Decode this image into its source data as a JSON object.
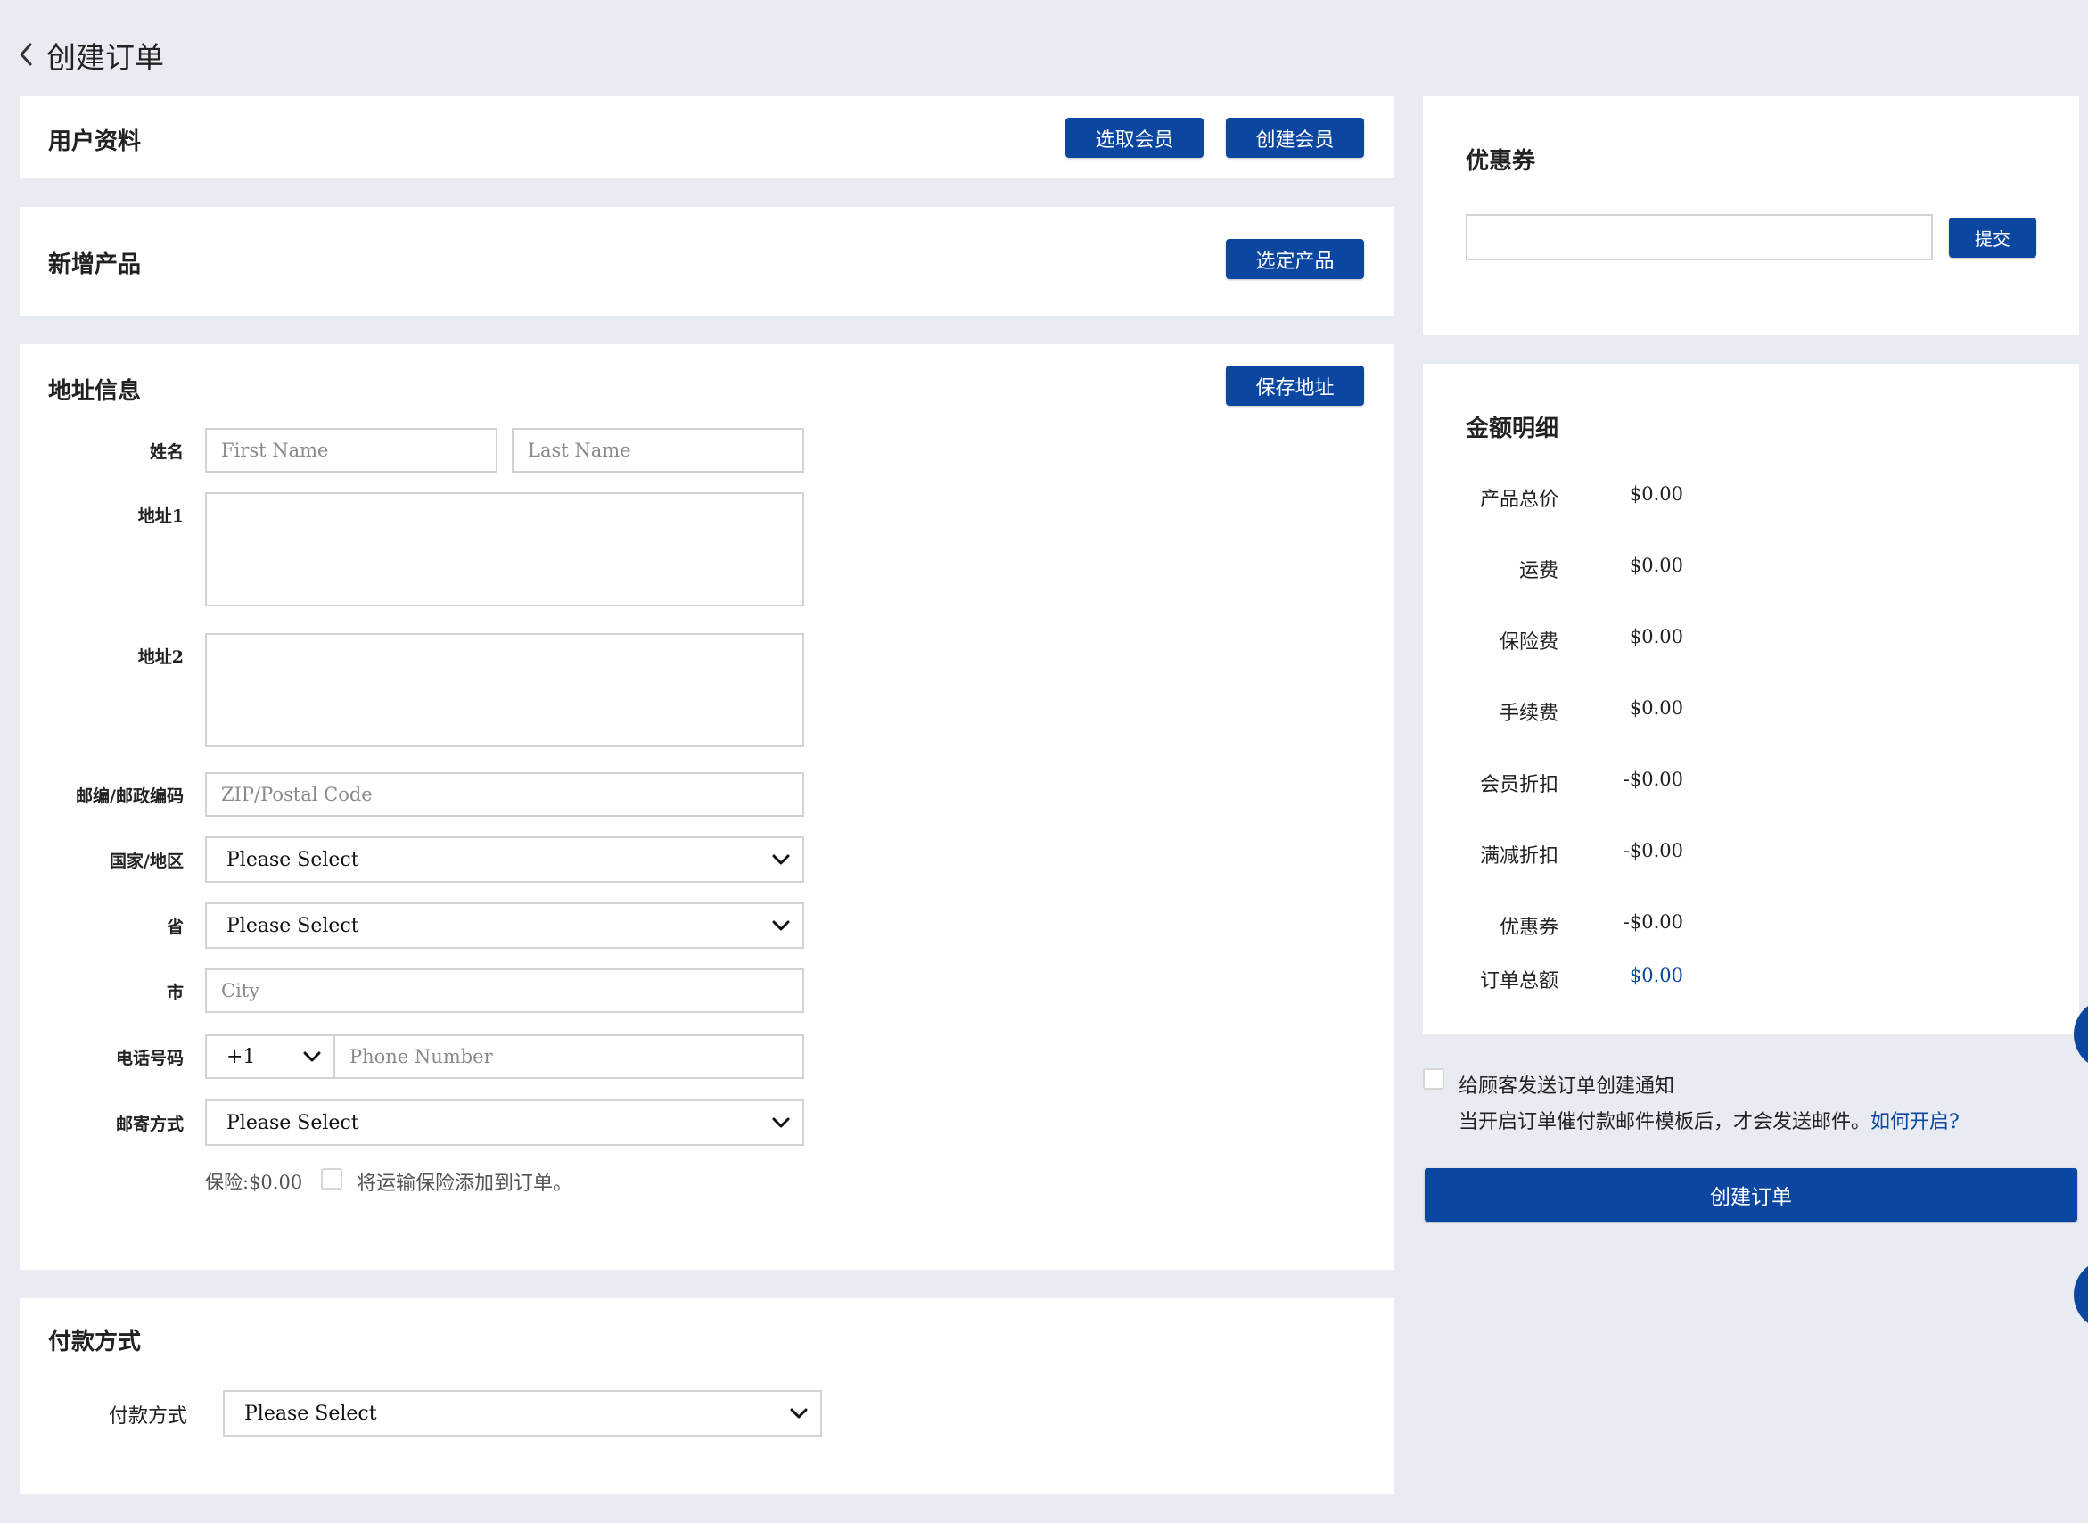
{
  "header": {
    "title": "创建订单"
  },
  "user_section": {
    "title": "用户资料",
    "select_member": "选取会员",
    "create_member": "创建会员"
  },
  "product_section": {
    "title": "新增产品",
    "select_product": "选定产品"
  },
  "address_section": {
    "title": "地址信息",
    "save_address": "保存地址",
    "name_label": "姓名",
    "first_name_placeholder": "First Name",
    "last_name_placeholder": "Last Name",
    "address1_label": "地址1",
    "address2_label": "地址2",
    "zip_label": "邮编/邮政编码",
    "zip_placeholder": "ZIP/Postal Code",
    "country_label": "国家/地区",
    "country_value": "Please Select",
    "province_label": "省",
    "province_value": "Please Select",
    "city_label": "市",
    "city_placeholder": "City",
    "phone_label": "电话号码",
    "phone_code": "+1",
    "phone_placeholder": "Phone Number",
    "shipping_label": "邮寄方式",
    "shipping_value": "Please Select",
    "insurance_text": "保险:$0.00",
    "insurance_checkbox_label": "将运输保险添加到订单。"
  },
  "payment_section": {
    "title": "付款方式",
    "label": "付款方式",
    "value": "Please Select"
  },
  "coupon_section": {
    "title": "优惠券",
    "submit": "提交"
  },
  "summary": {
    "title": "金额明细",
    "rows": [
      {
        "label": "产品总价",
        "value": "$0.00"
      },
      {
        "label": "运费",
        "value": "$0.00"
      },
      {
        "label": "保险费",
        "value": "$0.00"
      },
      {
        "label": "手续费",
        "value": "$0.00"
      },
      {
        "label": "会员折扣",
        "value": "-$0.00"
      },
      {
        "label": "满减折扣",
        "value": "-$0.00"
      },
      {
        "label": "优惠券",
        "value": "-$0.00"
      }
    ],
    "total_label": "订单总额",
    "total_value": "$0.00"
  },
  "notify": {
    "label": "给顾客发送订单创建通知",
    "hint": "当开启订单催付款邮件模板后，才会发送邮件。",
    "link": "如何开启?"
  },
  "create_order_button": "创建订单",
  "colors": {
    "primary": "#0b47a1",
    "background": "#e8ebf2",
    "link": "#0b47a1"
  }
}
